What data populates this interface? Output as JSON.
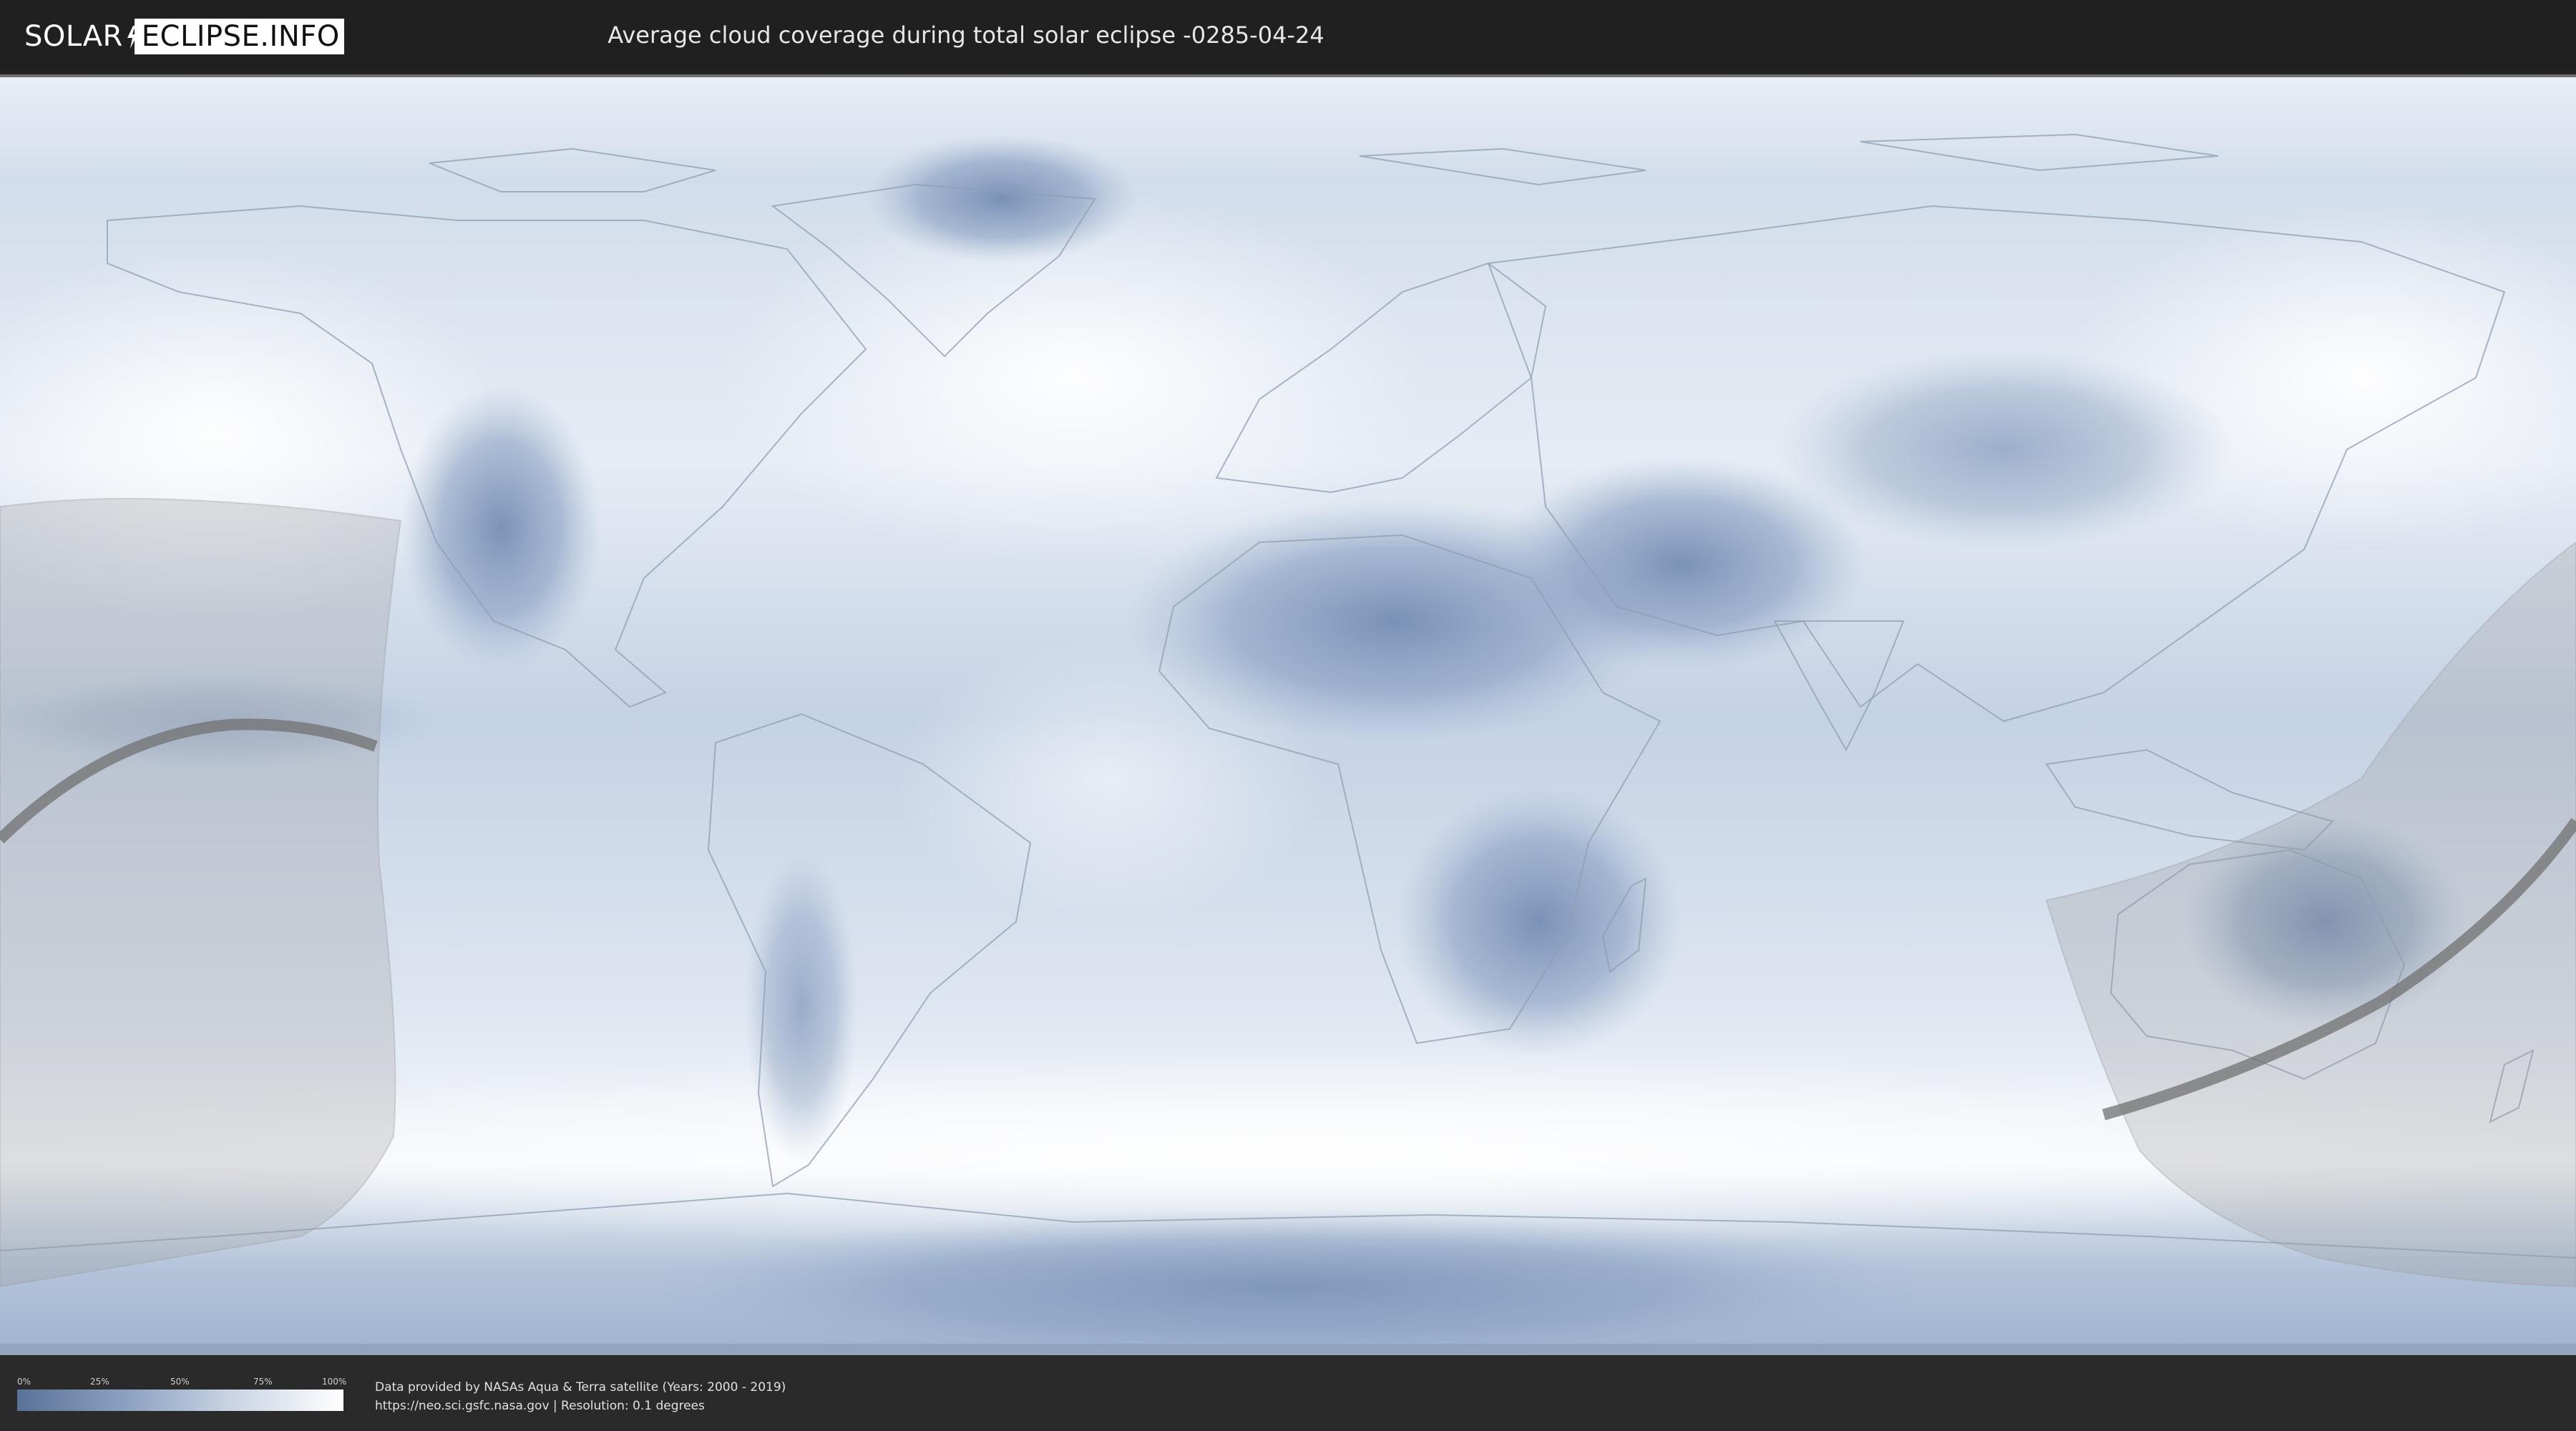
{
  "header": {
    "logo_left": "SOLAR",
    "logo_right": "ECLIPSE.INFO",
    "title": "Average cloud coverage during total solar eclipse -0285-04-24"
  },
  "legend": {
    "ticks": [
      "0%",
      "25%",
      "50%",
      "75%",
      "100%"
    ],
    "gradient_colors": [
      "#5a7298",
      "#8ea3c2",
      "#c9d3e3",
      "#ffffff"
    ]
  },
  "credits": {
    "line1": "Data provided by NASAs Aqua & Terra satellite (Years: 2000 - 2019)",
    "line2": "https://neo.sci.gsfc.nasa.gov | Resolution: 0.1 degrees"
  },
  "map": {
    "projection": "equirectangular",
    "layer": "cloud-coverage",
    "colors": {
      "clear": "#6f88b0",
      "cloudy": "#f4f7fb",
      "eclipse_zone": "#9a9a9a",
      "eclipse_path": "#707070"
    }
  }
}
